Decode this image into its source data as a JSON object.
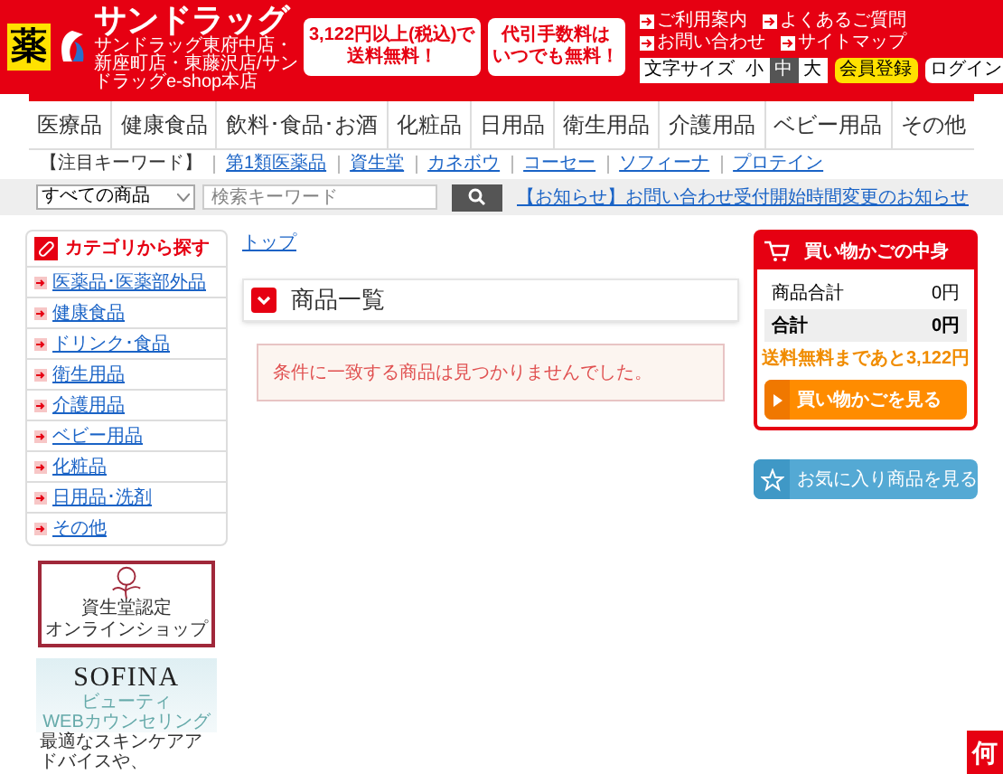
{
  "header": {
    "mark": "薬",
    "logo": "サンドラッグ",
    "logo_sub": "サンドラッグ東府中店・新座町店・東藤沢店/サンドラッグe-shop本店",
    "promos": [
      [
        "3,122円以上(税込)で",
        "送料無料！"
      ],
      [
        "代引手数料は",
        "いつでも無料！"
      ]
    ],
    "links": [
      "ご利用案内",
      "よくあるご質問",
      "お問い合わせ",
      "サイトマップ"
    ],
    "text_size_label": "文字サイズ",
    "text_sizes": [
      {
        "label": "小",
        "selected": false
      },
      {
        "label": "中",
        "selected": true
      },
      {
        "label": "大",
        "selected": false
      }
    ],
    "register": "会員登録",
    "login": "ログイン"
  },
  "nav": [
    "医療品",
    "健康食品",
    "飲料･食品･お酒",
    "化粧品",
    "日用品",
    "衛生用品",
    "介護用品",
    "ベビー用品",
    "その他"
  ],
  "keywords": {
    "label": "【注目キーワード】",
    "items": [
      "第1類医薬品",
      "資生堂",
      "カネボウ",
      "コーセー",
      "ソフィーナ",
      "プロテイン"
    ]
  },
  "search": {
    "category": "すべての商品",
    "placeholder": "検索キーワード"
  },
  "notice": "【お知らせ】お問い合わせ受付開始時間変更のお知らせ",
  "sidebar": {
    "title": "カテゴリから探す",
    "items": [
      "医薬品･医薬部外品",
      "健康食品",
      "ドリンク･食品",
      "衛生用品",
      "介護用品",
      "ベビー用品",
      "化粧品",
      "日用品･洗剤",
      "その他"
    ],
    "badge": [
      "資生堂認定",
      "オンラインショップ"
    ],
    "banner": {
      "brand": "SOFINA",
      "line1": "ビューティ",
      "line2": "WEBカウンセリング",
      "text": "最適なスキンケアアドバイスや、"
    }
  },
  "breadcrumb": "トップ",
  "heading": "商品一覧",
  "message": "条件に一致する商品は見つかりませんでした。",
  "cart": {
    "title": "買い物かごの中身",
    "rows": [
      {
        "label": "商品合計",
        "value": "0円",
        "kind": "subtotal"
      },
      {
        "label": "合計",
        "value": "0円",
        "kind": "total"
      }
    ],
    "free_shipping": "送料無料まであと3,122円",
    "view_button": "買い物かごを見る"
  },
  "favorites_button": "お気に入り商品を見る",
  "chat": "何"
}
